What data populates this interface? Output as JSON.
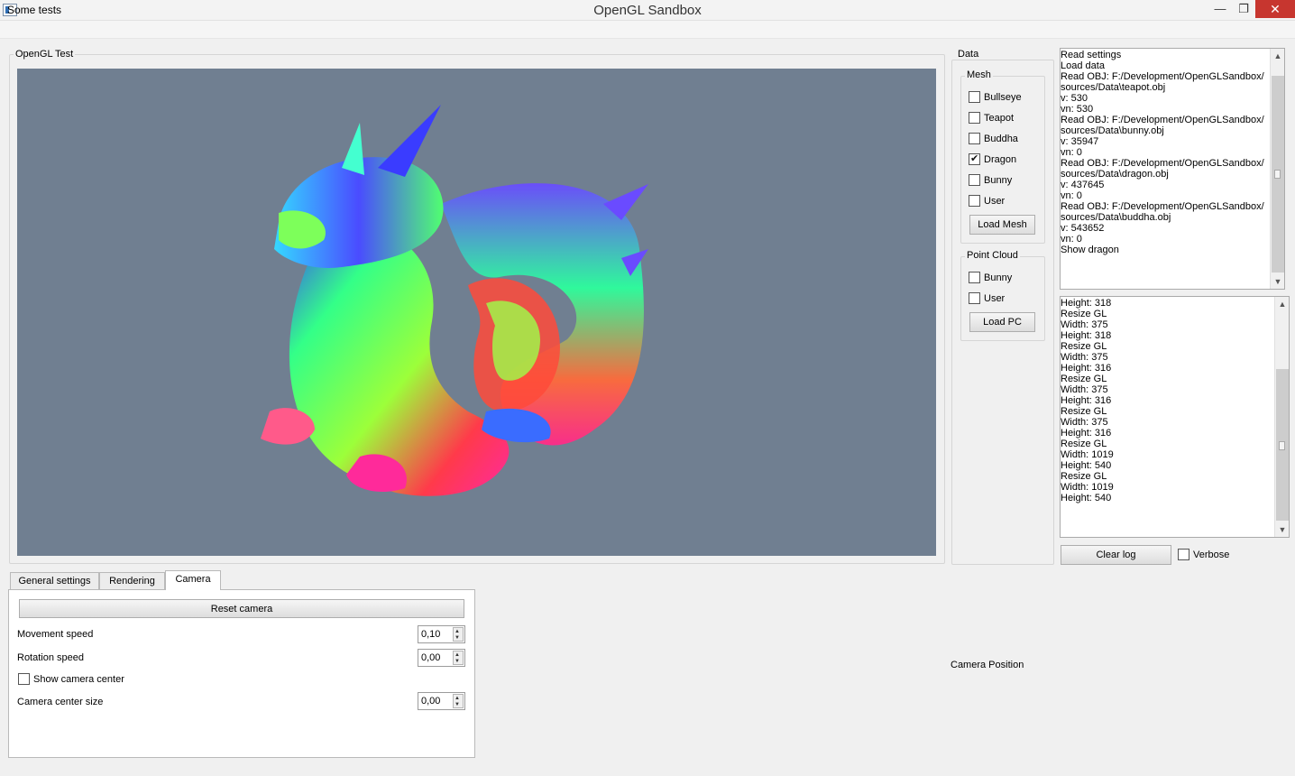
{
  "window": {
    "title": "OpenGL Sandbox",
    "minimize_glyph": "—",
    "maximize_glyph": "❐",
    "close_glyph": "✕"
  },
  "menu": [
    "Some tests"
  ],
  "gl_panel": {
    "title": "OpenGL Test",
    "background": "#707f91"
  },
  "data_panel": {
    "title": "Data",
    "mesh": {
      "title": "Mesh",
      "items": [
        {
          "label": "Bullseye",
          "checked": false
        },
        {
          "label": "Teapot",
          "checked": false
        },
        {
          "label": "Buddha",
          "checked": false
        },
        {
          "label": "Dragon",
          "checked": true
        },
        {
          "label": "Bunny",
          "checked": false
        },
        {
          "label": "User",
          "checked": false
        }
      ],
      "load_button": "Load Mesh"
    },
    "point_cloud": {
      "title": "Point Cloud",
      "items": [
        {
          "label": "Bunny",
          "checked": false
        },
        {
          "label": "User",
          "checked": false
        }
      ],
      "load_button": "Load PC"
    }
  },
  "log_top": [
    "Read settings",
    "Load data",
    "Read OBJ: F:/Development/OpenGLSandbox/",
    "sources/Data\\teapot.obj",
    "v: 530",
    "vn: 530",
    "Read OBJ: F:/Development/OpenGLSandbox/",
    "sources/Data\\bunny.obj",
    "v: 35947",
    "vn: 0",
    "Read OBJ: F:/Development/OpenGLSandbox/",
    "sources/Data\\dragon.obj",
    "v: 437645",
    "vn: 0",
    "Read OBJ: F:/Development/OpenGLSandbox/",
    "sources/Data\\buddha.obj",
    "v: 543652",
    "vn: 0",
    "Show dragon"
  ],
  "log_bottom": [
    "Height: 318",
    "Resize GL",
    "Width: 375",
    "Height: 318",
    "Resize GL",
    "Width: 375",
    "Height: 316",
    "Resize GL",
    "Width: 375",
    "Height: 316",
    "Resize GL",
    "Width: 375",
    "Height: 316",
    "Resize GL",
    "Width: 1019",
    "Height: 540",
    "Resize GL",
    "Width: 1019",
    "Height: 540"
  ],
  "log_controls": {
    "clear_button": "Clear log",
    "verbose_label": "Verbose",
    "verbose_checked": false
  },
  "tabs": [
    {
      "label": "General settings",
      "active": false
    },
    {
      "label": "Rendering",
      "active": false
    },
    {
      "label": "Camera",
      "active": true
    }
  ],
  "camera": {
    "reset_button": "Reset camera",
    "movement_speed": {
      "label": "Movement speed",
      "value": "0,10"
    },
    "rotation_speed": {
      "label": "Rotation speed",
      "value": "0,00"
    },
    "show_center": {
      "label": "Show camera center",
      "checked": false
    },
    "center_size": {
      "label": "Camera center size",
      "value": "0,00"
    }
  },
  "camera_position_label": "Camera Position"
}
